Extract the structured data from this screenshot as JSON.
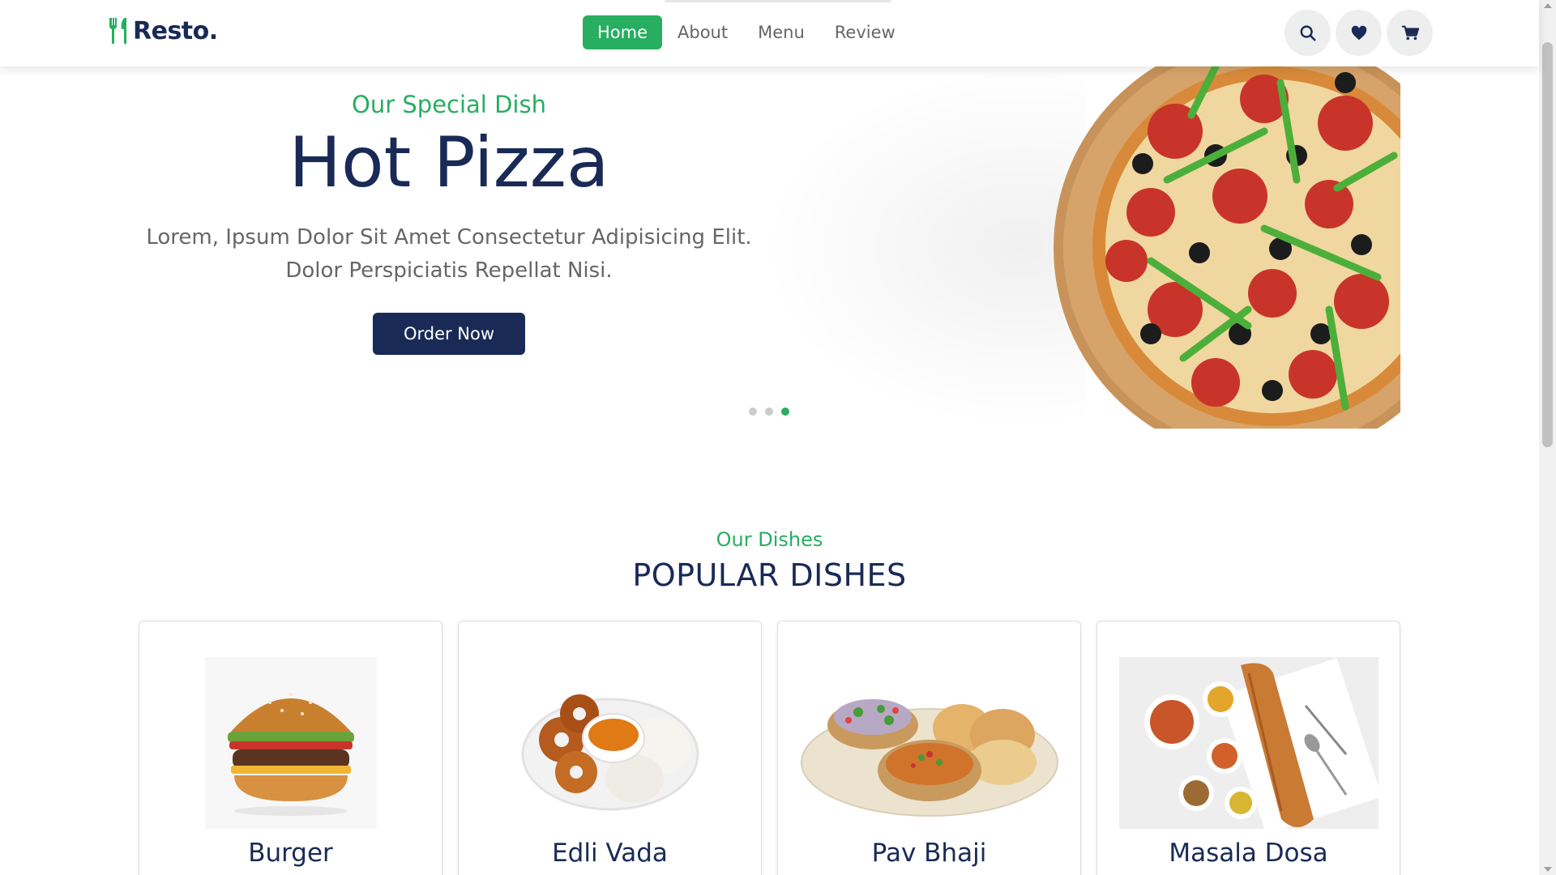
{
  "brand": {
    "name": "Resto.",
    "accent": "#27ae60",
    "primary": "#192a56"
  },
  "nav": {
    "items": [
      {
        "label": "Home",
        "active": true
      },
      {
        "label": "About",
        "active": false
      },
      {
        "label": "Menu",
        "active": false
      },
      {
        "label": "Review",
        "active": false
      }
    ]
  },
  "header_icons": [
    "search-icon",
    "heart-icon",
    "cart-icon"
  ],
  "hero": {
    "subtitle": "Our Special Dish",
    "title": "Hot Pizza",
    "description_line1": "Lorem, Ipsum Dolor Sit Amet Consectetur Adipisicing Elit.",
    "description_line2": "Dolor Perspiciatis Repellat Nisi.",
    "button": "Order Now",
    "slides": 3,
    "active_slide": 3
  },
  "dishes": {
    "subtitle": "Our Dishes",
    "title": "POPULAR DISHES",
    "items": [
      {
        "name": "Burger"
      },
      {
        "name": "Edli Vada"
      },
      {
        "name": "Pav Bhaji"
      },
      {
        "name": "Masala Dosa"
      }
    ]
  }
}
